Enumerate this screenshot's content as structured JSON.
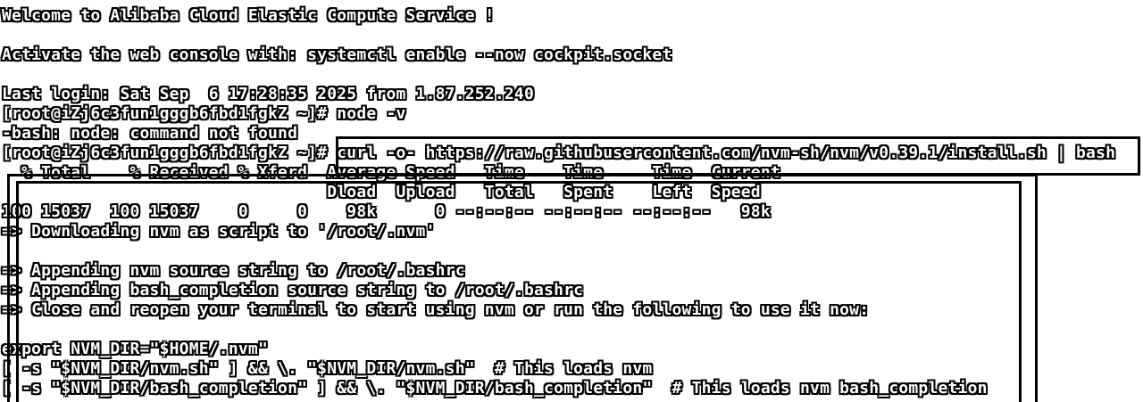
{
  "terminal": {
    "lines": [
      "Welcome to Alibaba Cloud Elastic Compute Service !",
      "",
      "Activate the web console with: systemctl enable --now cockpit.socket",
      "",
      "Last login: Sat Sep  6 17:28:35 2025 from 1.87.252.240",
      "[root@iZj6c3fun1gggb6fbd1fgkZ ~]# node -v",
      "-bash: node: command not found",
      "[root@iZj6c3fun1gggb6fbd1fgkZ ~]# curl -o- https://raw.githubusercontent.com/nvm-sh/nvm/v0.39.1/install.sh | bash",
      "  % Total    % Received % Xferd  Average Speed   Time    Time     Time  Current",
      "                                 Dload  Upload   Total   Spent    Left  Speed",
      "100 15037  100 15037    0     0    98k      0 --:--:-- --:--:-- --:--:--   98k",
      "=> Downloading nvm as script to '/root/.nvm'",
      "",
      "=> Appending nvm source string to /root/.bashrc",
      "=> Appending bash_completion source string to /root/.bashrc",
      "=> Close and reopen your terminal to start using nvm or run the following to use it now:",
      "",
      "export NVM_DIR=\"$HOME/.nvm\"",
      "[ -s \"$NVM_DIR/nvm.sh\" ] && \\. \"$NVM_DIR/nvm.sh\"  # This loads nvm",
      "[ -s \"$NVM_DIR/bash_completion\" ] && \\. \"$NVM_DIR/bash_completion\"  # This loads nvm bash_completion"
    ]
  },
  "colors": {
    "background": "#ffffff",
    "text": "#ffffff",
    "text_outline": "#000000",
    "highlight_border": "#000000"
  }
}
